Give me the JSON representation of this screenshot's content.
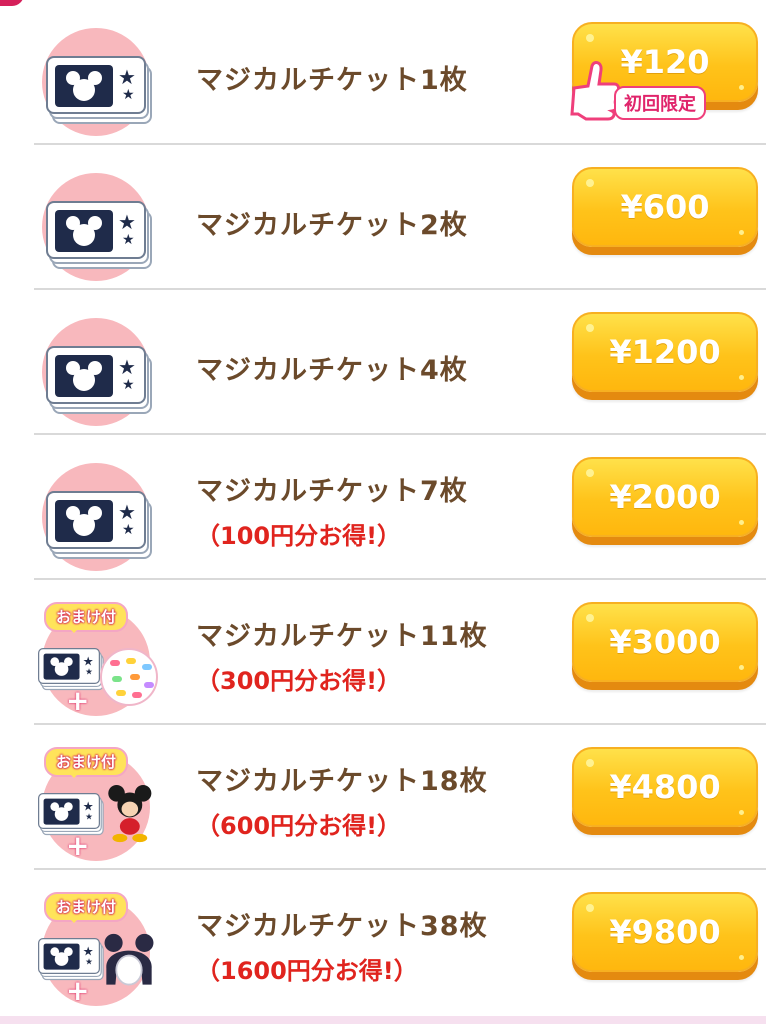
{
  "colors": {
    "title_text": "#6b4a2b",
    "deal_text": "#e0241e",
    "button": "#ffc31a",
    "button_shadow": "#e48a10",
    "pack_circle": "#f8b8bd",
    "badge_text": "#e0246b"
  },
  "shop": {
    "items": [
      {
        "title": "マジカルチケット1枚",
        "deal": "",
        "price": "¥120",
        "badge": "初回限定",
        "bonus": ""
      },
      {
        "title": "マジカルチケット2枚",
        "deal": "",
        "price": "¥600",
        "badge": "",
        "bonus": ""
      },
      {
        "title": "マジカルチケット4枚",
        "deal": "",
        "price": "¥1200",
        "badge": "",
        "bonus": ""
      },
      {
        "title": "マジカルチケット7枚",
        "deal": "（100円分お得!）",
        "price": "¥2000",
        "badge": "",
        "bonus": ""
      },
      {
        "title": "マジカルチケット11枚",
        "deal": "（300円分お得!）",
        "price": "¥3000",
        "badge": "",
        "bonus": "おまけ付"
      },
      {
        "title": "マジカルチケット18枚",
        "deal": "（600円分お得!）",
        "price": "¥4800",
        "badge": "",
        "bonus": "おまけ付"
      },
      {
        "title": "マジカルチケット38枚",
        "deal": "（1600円分お得!）",
        "price": "¥9800",
        "badge": "",
        "bonus": "おまけ付"
      }
    ]
  },
  "icons": {
    "ticket": "magic-ticket-icon",
    "bonus_item_11": "ball-pit-icon",
    "bonus_item_18": "mickey-figure-icon",
    "bonus_item_38": "avatar-hair-icon",
    "first_time_badge": "thumbs-up-icon"
  }
}
